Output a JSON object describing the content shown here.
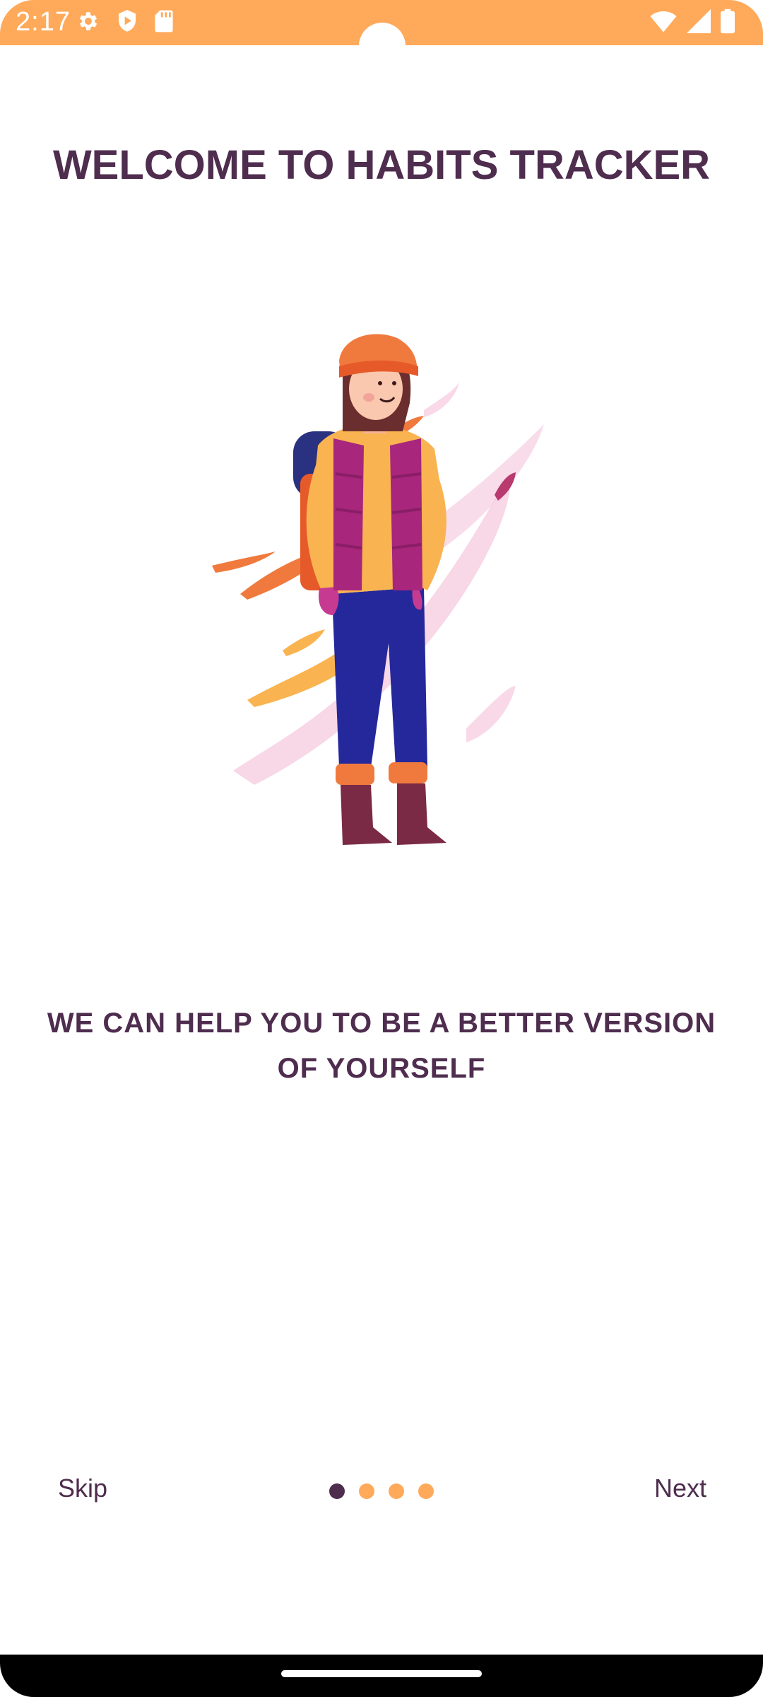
{
  "status_bar": {
    "time": "2:17",
    "background_color": "#FFAA5A",
    "left_icons": [
      "gear-icon",
      "shield-play-icon",
      "sd-card-icon"
    ],
    "right_icons": [
      "wifi-icon",
      "signal-icon",
      "battery-icon"
    ]
  },
  "onboarding": {
    "title": "WELCOME TO HABITS TRACKER",
    "subtitle": "WE CAN HELP YOU TO BE A BETTER VERSION OF YOURSELF",
    "illustration": "hiker-woman-illustration",
    "skip_label": "Skip",
    "next_label": "Next",
    "page_indicator": {
      "total": 4,
      "current": 1,
      "active_color": "#4E2D4E",
      "inactive_color": "#FFAA5A"
    }
  },
  "colors": {
    "text": "#4E2D4E",
    "accent": "#FFAA5A"
  }
}
